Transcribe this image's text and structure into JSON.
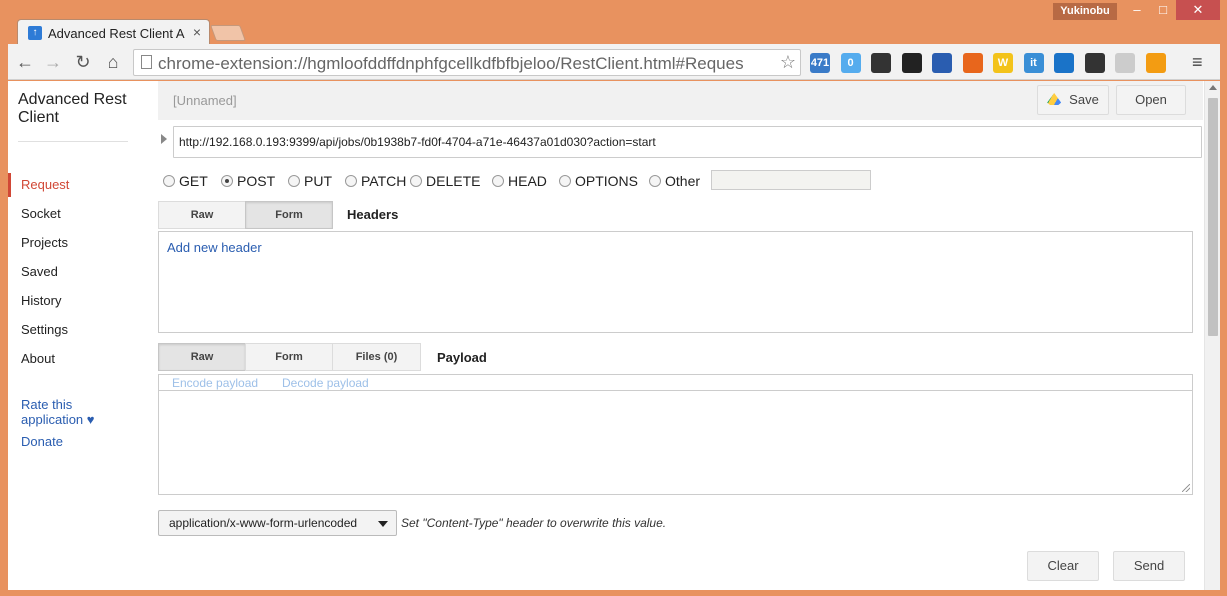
{
  "window": {
    "user": "Yukinobu",
    "minimize": "–",
    "maximize": "□",
    "close": "✕"
  },
  "browser": {
    "tab_title": "Advanced Rest Client A",
    "url": "chrome-extension://hgmloofddffdnphfgcellkdfbfbjeloo/RestClient.html#Reques",
    "extensions": [
      {
        "icon": "cloud-icon",
        "label": "471",
        "color": "#3a7bc8"
      },
      {
        "icon": "twitter-icon",
        "label": "0",
        "color": "#55acee"
      },
      {
        "icon": "phone-icon",
        "label": "",
        "color": "#333333"
      },
      {
        "icon": "circle-icon",
        "label": "",
        "color": "#222222"
      },
      {
        "icon": "bar-chart-icon",
        "label": "",
        "color": "#2a5db0"
      },
      {
        "icon": "cart-icon",
        "label": "",
        "color": "#e8661c"
      },
      {
        "icon": "w-icon",
        "label": "W",
        "color": "#f3c31b"
      },
      {
        "icon": "it-icon",
        "label": "it",
        "color": "#3a8fd6"
      },
      {
        "icon": "window-icon",
        "label": "",
        "color": "#1a73c8"
      },
      {
        "icon": "film-icon",
        "label": "",
        "color": "#333333"
      },
      {
        "icon": "gauge-icon",
        "label": "",
        "color": "#cccccc"
      },
      {
        "icon": "share-icon",
        "label": "",
        "color": "#f39c12"
      }
    ]
  },
  "sidebar": {
    "title": "Advanced Rest Client",
    "items": [
      {
        "label": "Request",
        "active": true
      },
      {
        "label": "Socket"
      },
      {
        "label": "Projects"
      },
      {
        "label": "Saved"
      },
      {
        "label": "History"
      },
      {
        "label": "Settings"
      },
      {
        "label": "About"
      }
    ],
    "rate": "Rate this application ♥",
    "donate": "Donate"
  },
  "request": {
    "name": "[Unnamed]",
    "save_label": "Save",
    "open_label": "Open",
    "url": "http://192.168.0.193:9399/api/jobs/0b1938b7-fd0f-4704-a71e-46437a01d030?action=start",
    "methods": [
      "GET",
      "POST",
      "PUT",
      "PATCH",
      "DELETE",
      "HEAD",
      "OPTIONS",
      "Other"
    ],
    "selected_method": "POST",
    "headers_tabs": [
      "Raw",
      "Form"
    ],
    "headers_label": "Headers",
    "add_header": "Add new header",
    "payload_tabs": [
      "Raw",
      "Form",
      "Files (0)"
    ],
    "payload_label": "Payload",
    "encode_payload": "Encode payload",
    "decode_payload": "Decode payload",
    "content_type": "application/x-www-form-urlencoded",
    "content_type_note": "Set \"Content-Type\" header to overwrite this value.",
    "clear_label": "Clear",
    "send_label": "Send"
  }
}
